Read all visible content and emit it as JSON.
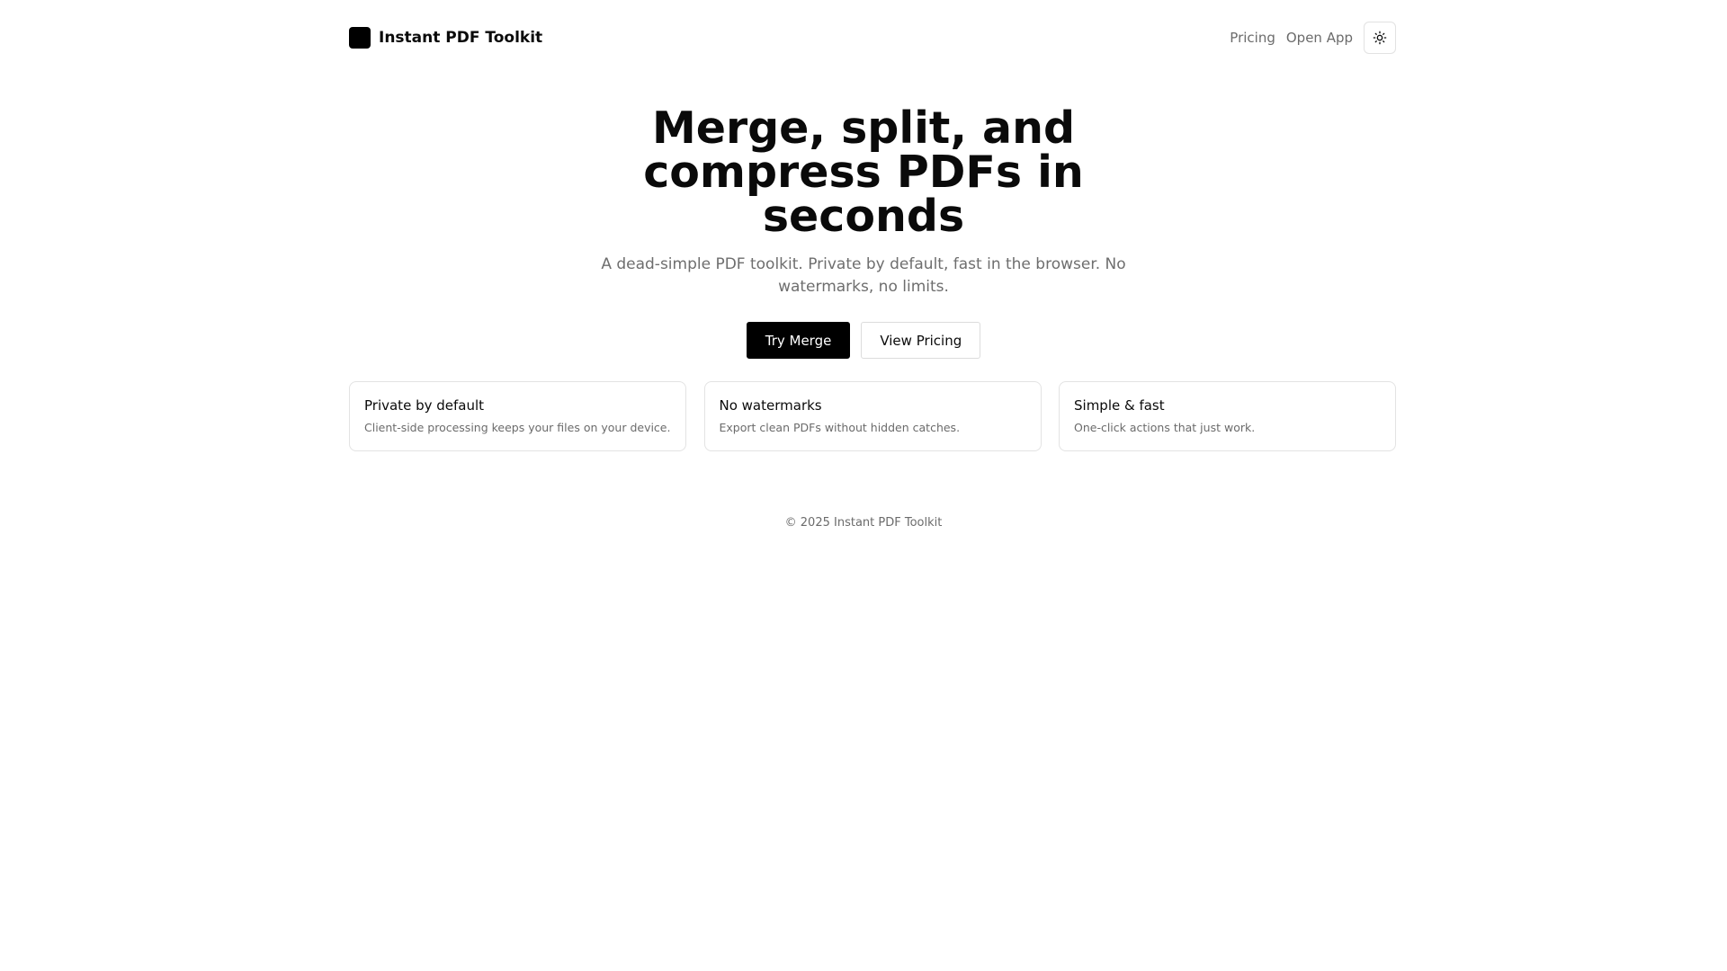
{
  "header": {
    "brand_name": "Instant PDF Toolkit",
    "nav": [
      {
        "label": "Pricing"
      },
      {
        "label": "Open App"
      }
    ],
    "theme_toggle_icon": "sun-icon"
  },
  "hero": {
    "title_line1": "Merge, split, and",
    "title_line2": "compress PDFs in seconds",
    "subtitle": "A dead-simple PDF toolkit. Private by default, fast in the browser. No watermarks, no limits.",
    "primary_cta": "Try Merge",
    "secondary_cta": "View Pricing"
  },
  "features": [
    {
      "title": "Private by default",
      "description": "Client-side processing keeps your files on your device."
    },
    {
      "title": "No watermarks",
      "description": "Export clean PDFs without hidden catches."
    },
    {
      "title": "Simple & fast",
      "description": "One-click actions that just work."
    }
  ],
  "footer": {
    "copyright": "© 2025 Instant PDF Toolkit"
  },
  "colors": {
    "primary": "#000000",
    "muted_text": "#6b6b6b",
    "border": "#e3e3e3",
    "background": "#ffffff"
  }
}
